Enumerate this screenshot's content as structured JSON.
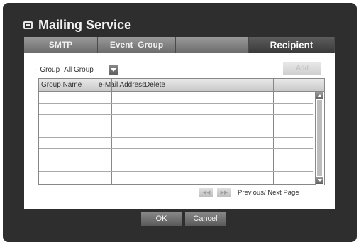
{
  "window": {
    "title": "Mailing Service",
    "icon": "monitor-icon"
  },
  "tabs": [
    {
      "label": "SMTP",
      "active": false
    },
    {
      "label": "Event  Group",
      "active": false
    },
    {
      "label": "",
      "active": false
    },
    {
      "label": "Recipient",
      "active": true
    }
  ],
  "filter": {
    "bullet": "·",
    "label": "Group",
    "selected": "All Group",
    "add_label": "Add"
  },
  "table": {
    "columns": [
      "Group Name",
      "e-Mail Address",
      "Delete",
      ""
    ],
    "rows": [
      [
        "",
        "",
        "",
        ""
      ],
      [
        "",
        "",
        "",
        ""
      ],
      [
        "",
        "",
        "",
        ""
      ],
      [
        "",
        "",
        "",
        ""
      ],
      [
        "",
        "",
        "",
        ""
      ],
      [
        "",
        "",
        "",
        ""
      ],
      [
        "",
        "",
        "",
        ""
      ],
      [
        "",
        "",
        "",
        ""
      ]
    ]
  },
  "pager": {
    "prev_icon": "rewind-icon",
    "next_icon": "fast-forward-icon",
    "prev_glyph": "◀◀",
    "next_glyph": "▶▶",
    "label": "Previous/ Next Page"
  },
  "footer": {
    "ok_label": "OK",
    "cancel_label": "Cancel"
  },
  "colors": {
    "frame": "#2e2e2e",
    "tab": "#7a7a7a",
    "tab_active": "#474747",
    "panel": "#ffffff"
  }
}
